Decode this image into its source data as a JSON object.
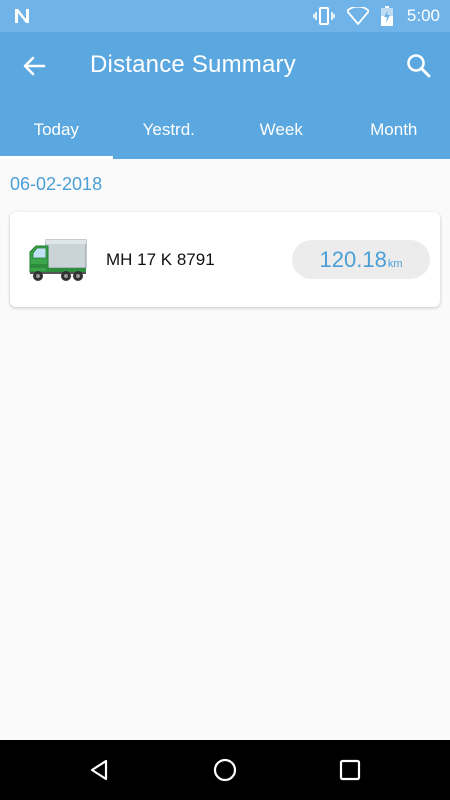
{
  "status_bar": {
    "time": "5:00",
    "icons": [
      "n-notification-icon",
      "vibrate-icon",
      "wifi-icon",
      "battery-charging-icon"
    ]
  },
  "app_bar": {
    "title": "Distance Summary",
    "back_icon": "arrow-back-icon",
    "search_icon": "search-icon"
  },
  "tabs": [
    {
      "label": "Today",
      "active": true
    },
    {
      "label": "Yestrd.",
      "active": false
    },
    {
      "label": "Week",
      "active": false
    },
    {
      "label": "Month",
      "active": false
    }
  ],
  "date": "06-02-2018",
  "vehicles": [
    {
      "icon": "green-truck-icon",
      "plate": "MH 17 K 8791",
      "distance": "120.18",
      "unit": "km"
    }
  ],
  "nav_bar": {
    "icons": [
      "nav-back-icon",
      "nav-home-icon",
      "nav-recents-icon"
    ]
  },
  "colors": {
    "status_bar": "#6fb3e8",
    "app_bar": "#5ba7df",
    "accent_text": "#4a9fd6",
    "background": "#fafafa",
    "pill": "#ececec",
    "truck_cab": "#3aa54a"
  }
}
